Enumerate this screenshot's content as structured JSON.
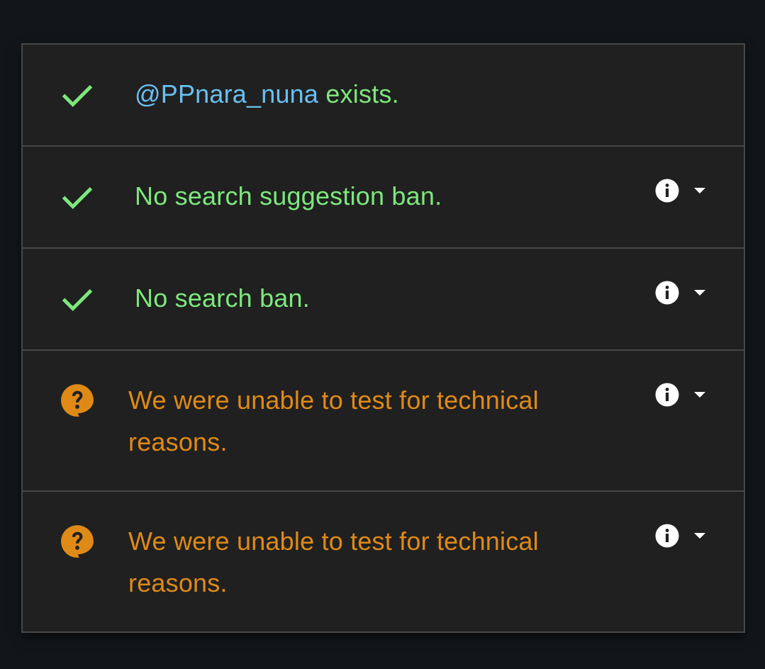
{
  "results": [
    {
      "status": "ok",
      "icon": "check-icon",
      "handle": "@PPnara_nuna",
      "text": " exists.",
      "has_actions": false
    },
    {
      "status": "ok",
      "icon": "check-icon",
      "text": "No search suggestion ban.",
      "has_actions": true
    },
    {
      "status": "ok",
      "icon": "check-icon",
      "text": "No search ban.",
      "has_actions": true
    },
    {
      "status": "unknown",
      "icon": "question-bubble-icon",
      "text": "We were unable to test for technical reasons.",
      "has_actions": true
    },
    {
      "status": "unknown",
      "icon": "question-bubble-icon",
      "text": "We were unable to test for technical reasons.",
      "has_actions": true
    }
  ],
  "colors": {
    "page_background": "#12161a",
    "panel_background": "#202020",
    "border": "#474747",
    "ok": "#7ce87c",
    "handle": "#68c0f2",
    "warning": "#df8a17",
    "icon_white": "#ffffff"
  },
  "action_icons": [
    "info-icon",
    "caret-down-icon"
  ]
}
